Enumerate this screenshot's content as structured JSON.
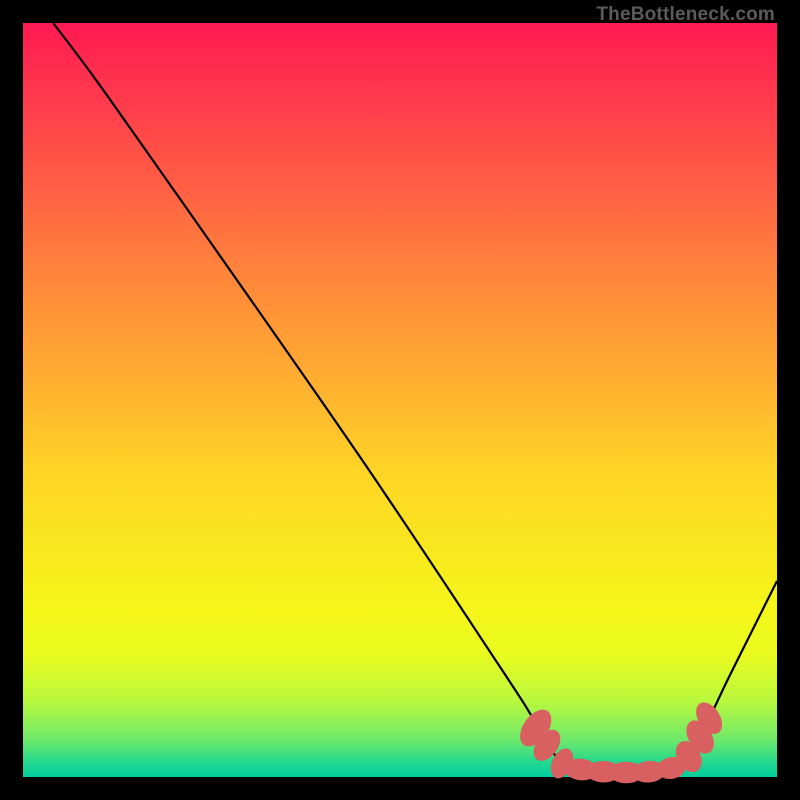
{
  "watermark": "TheBottleneck.com",
  "chart_data": {
    "type": "line",
    "title": "",
    "xlabel": "",
    "ylabel": "",
    "xlim": [
      0,
      100
    ],
    "ylim": [
      0,
      100
    ],
    "curve": [
      {
        "x": 4.0,
        "y": 100.0
      },
      {
        "x": 10.0,
        "y": 92.0
      },
      {
        "x": 22.0,
        "y": 75.0
      },
      {
        "x": 45.0,
        "y": 42.0
      },
      {
        "x": 63.0,
        "y": 15.0
      },
      {
        "x": 67.5,
        "y": 8.0
      },
      {
        "x": 70.0,
        "y": 3.5
      },
      {
        "x": 74.0,
        "y": 1.0
      },
      {
        "x": 80.0,
        "y": 0.5
      },
      {
        "x": 86.0,
        "y": 1.2
      },
      {
        "x": 89.5,
        "y": 5.0
      },
      {
        "x": 94.0,
        "y": 14.0
      },
      {
        "x": 100.0,
        "y": 26.0
      }
    ],
    "markers": [
      {
        "x": 68.0,
        "y": 6.5,
        "rx": 3.0,
        "ry": 5.0,
        "rot": 35
      },
      {
        "x": 69.5,
        "y": 4.2,
        "rx": 2.6,
        "ry": 4.2,
        "rot": 35
      },
      {
        "x": 71.5,
        "y": 1.8,
        "rx": 2.4,
        "ry": 3.8,
        "rot": 25
      },
      {
        "x": 74.0,
        "y": 1.0,
        "rx": 4.0,
        "ry": 2.6,
        "rot": 5
      },
      {
        "x": 77.0,
        "y": 0.7,
        "rx": 4.2,
        "ry": 2.6,
        "rot": 0
      },
      {
        "x": 80.0,
        "y": 0.6,
        "rx": 4.2,
        "ry": 2.6,
        "rot": 0
      },
      {
        "x": 83.0,
        "y": 0.7,
        "rx": 4.0,
        "ry": 2.6,
        "rot": -5
      },
      {
        "x": 86.0,
        "y": 1.2,
        "rx": 3.6,
        "ry": 2.6,
        "rot": -12
      },
      {
        "x": 88.3,
        "y": 2.7,
        "rx": 2.8,
        "ry": 4.0,
        "rot": -30
      },
      {
        "x": 89.8,
        "y": 5.3,
        "rx": 2.8,
        "ry": 4.4,
        "rot": -32
      },
      {
        "x": 91.0,
        "y": 7.8,
        "rx": 2.6,
        "ry": 4.2,
        "rot": -32
      }
    ]
  }
}
